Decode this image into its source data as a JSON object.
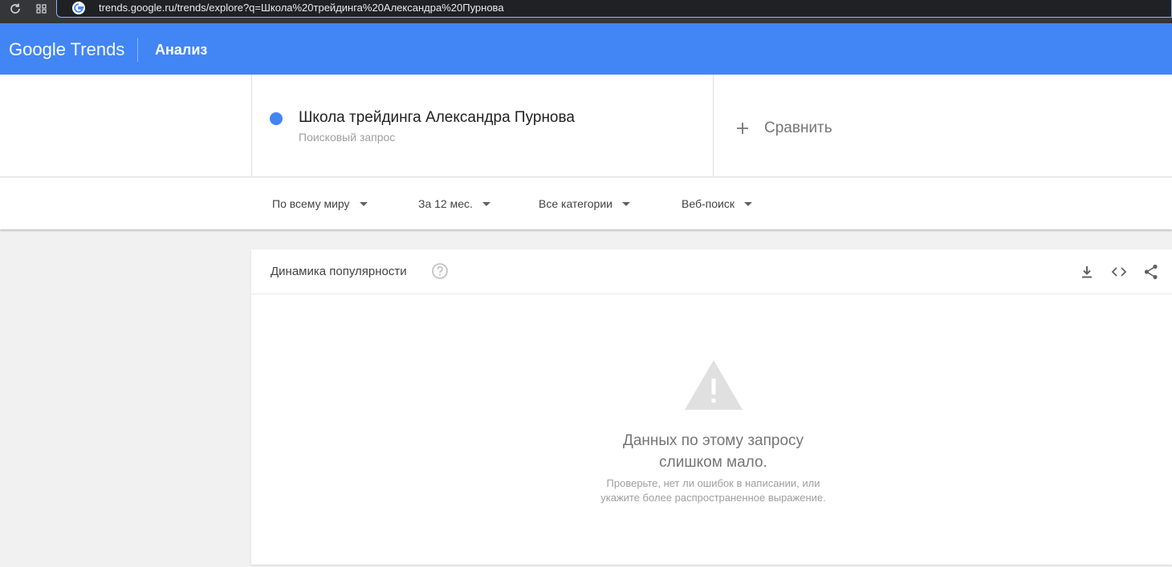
{
  "browser": {
    "url": "trends.google.ru/trends/explore?q=Школа%20трейдинга%20Александра%20Пурнова"
  },
  "header": {
    "logo_google": "Google",
    "logo_trends": "Trends",
    "title": "Анализ"
  },
  "search_term": {
    "name": "Школа трейдинга Александра Пурнова",
    "type": "Поисковый запрос",
    "color": "#4285f4"
  },
  "compare": {
    "label": "Сравнить"
  },
  "filters": [
    {
      "label": "По всему миру"
    },
    {
      "label": "За 12 мес."
    },
    {
      "label": "Все категории"
    },
    {
      "label": "Веб-поиск"
    }
  ],
  "interest_card": {
    "title": "Динамика популярности",
    "empty_title_line1": "Данных по этому запросу",
    "empty_title_line2": "слишком мало.",
    "empty_hint_line1": "Проверьте, нет ли ошибок в написании, или",
    "empty_hint_line2": "укажите более распространенное выражение."
  },
  "colors": {
    "brand_blue": "#4285f4",
    "browser_dark": "#35363a"
  }
}
